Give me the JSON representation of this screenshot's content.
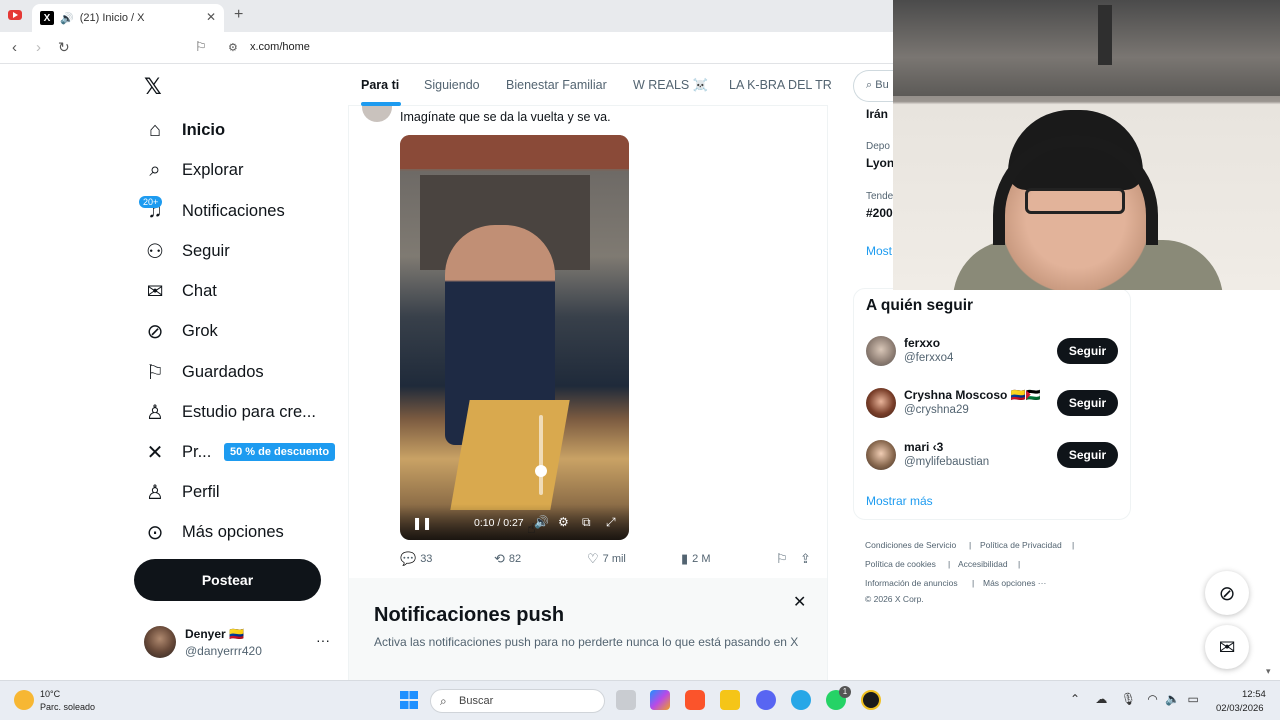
{
  "browser": {
    "tab_title": "(21) Inicio / X",
    "new_tab": "+",
    "url": "x.com/home",
    "tab_icon": "X"
  },
  "sidebar": {
    "items": [
      {
        "label": "Inicio",
        "icon": "home-icon",
        "glyph": "⌂"
      },
      {
        "label": "Explorar",
        "icon": "search-icon",
        "glyph": "⌕"
      },
      {
        "label": "Notificaciones",
        "icon": "bell-icon",
        "glyph": "♫"
      },
      {
        "label": "Seguir",
        "icon": "person-add-icon",
        "glyph": "⚇"
      },
      {
        "label": "Chat",
        "icon": "mail-icon",
        "glyph": "✉"
      },
      {
        "label": "Grok",
        "icon": "grok-icon",
        "glyph": "⊘"
      },
      {
        "label": "Guardados",
        "icon": "bookmark-icon",
        "glyph": "⚐"
      },
      {
        "label": "Estudio para cre...",
        "icon": "creator-studio-icon",
        "glyph": "♙"
      },
      {
        "label": "Pr...",
        "icon": "x-premium-icon",
        "glyph": "✕"
      },
      {
        "label": "Perfil",
        "icon": "profile-icon",
        "glyph": "♙"
      },
      {
        "label": "Más opciones",
        "icon": "more-options-icon",
        "glyph": "⊙"
      }
    ],
    "notif_badge": "20+",
    "promo_badge": "50 % de descuento",
    "post_button": "Postear",
    "logo": "𝕏",
    "user": {
      "name": "Denyer 🇨🇴",
      "handle": "@danyerrr420",
      "more": "···"
    }
  },
  "feed": {
    "tabs": [
      "Para ti",
      "Siguiendo",
      "Bienestar Familiar",
      "W REALS ☠️",
      "LA K-BRA DEL TR"
    ],
    "post": {
      "text": "Imagínate que se da la vuelta y se va.",
      "video_time": "0:10 / 0:27",
      "video_progress": 0.37,
      "volume_level": 0.3,
      "actions": {
        "replies": "33",
        "reposts": "82",
        "likes": "7 mil",
        "views": "2 M"
      }
    }
  },
  "push": {
    "title": "Notificaciones push",
    "body": "Activa las notificaciones push para no perderte nunca lo que está pasando en X",
    "close": "✕"
  },
  "right": {
    "search_placeholder": "Bu",
    "trends": [
      {
        "category": "",
        "name": "Irán"
      },
      {
        "category": "Depo",
        "name": "Lyon"
      },
      {
        "category": "Tende",
        "name": "#200"
      }
    ],
    "trends_more": "Most",
    "follow_title": "A quién seguir",
    "follow": [
      {
        "name": "ferxxo",
        "handle": "@ferxxo4",
        "button": "Seguir"
      },
      {
        "name": "Cryshna Moscoso 🇨🇴🇵🇸",
        "handle": "@cryshna29",
        "button": "Seguir"
      },
      {
        "name": "mari ‹3",
        "handle": "@mylifebaustian",
        "button": "Seguir"
      }
    ],
    "follow_more": "Mostrar más",
    "footer": [
      "Condiciones de Servicio",
      "Política de Privacidad",
      "Política de cookies",
      "Accesibilidad",
      "Información de anuncios",
      "Más opciones ···",
      "© 2026 X Corp."
    ]
  },
  "taskbar": {
    "weather_temp": "10°C",
    "weather_desc": "Parc. soleado",
    "search": "Buscar",
    "time": "12:54",
    "date": "02/03/2026",
    "whatsapp_badge": "1"
  },
  "colors": {
    "accent": "#1d9bf0",
    "text": "#0f1419",
    "muted": "#536471"
  }
}
